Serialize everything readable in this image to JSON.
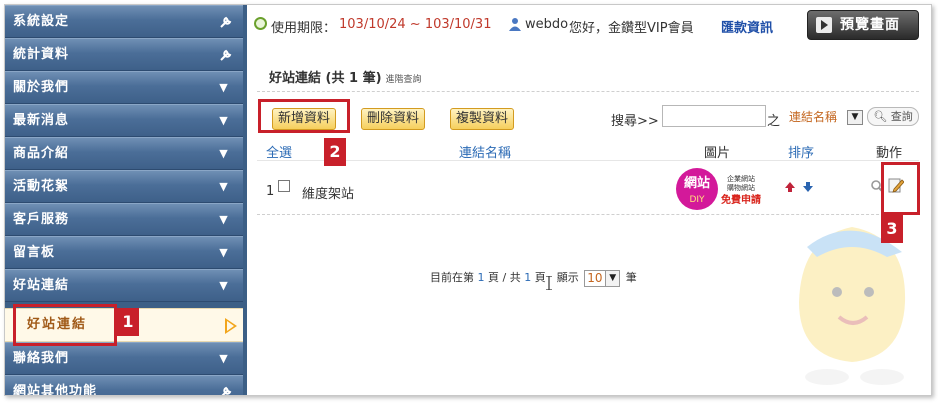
{
  "sidebar": {
    "items": [
      {
        "label": "系統設定",
        "icon": "wrench-icon"
      },
      {
        "label": "統計資料",
        "icon": "wrench-icon"
      },
      {
        "label": "關於我們",
        "icon": "chevron-down-icon"
      },
      {
        "label": "最新消息",
        "icon": "chevron-down-icon"
      },
      {
        "label": "商品介紹",
        "icon": "chevron-down-icon"
      },
      {
        "label": "活動花絮",
        "icon": "chevron-down-icon"
      },
      {
        "label": "客戶服務",
        "icon": "chevron-down-icon"
      },
      {
        "label": "留言板",
        "icon": "chevron-down-icon"
      },
      {
        "label": "好站連結",
        "icon": "chevron-down-icon"
      },
      {
        "label": "聯絡我們",
        "icon": "chevron-down-icon"
      },
      {
        "label": "網站其他功能",
        "icon": "wrench-icon"
      }
    ],
    "active_sub": "好站連結"
  },
  "topbar": {
    "usage_label": "使用期限：",
    "date_range": "103/10/24 ~ 103/10/31",
    "username": "webdo",
    "greeting": "您好，金鑽型VIP會員",
    "remit_link": "匯款資訊",
    "preview_button": "預覽畫面"
  },
  "page": {
    "title": "好站連結 (共 1 筆)",
    "advanced_search": "進階查詢"
  },
  "toolbar": {
    "new_label": "新增資料",
    "delete_label": "刪除資料",
    "copy_label": "複製資料"
  },
  "search": {
    "label": "搜尋>>",
    "value": "",
    "of_label": "之",
    "field_selected": "連結名稱",
    "query_button": "查詢"
  },
  "table": {
    "headers": {
      "select_all": "全選",
      "name": "連結名稱",
      "image": "圖片",
      "sort": "排序",
      "action": "動作"
    },
    "rows": [
      {
        "index": "1",
        "name": "維度架站",
        "image_text_top": "網站",
        "image_text_diy": "DIY",
        "image_text_line1": "企業網站",
        "image_text_line2": "購物網站",
        "image_text_free": "免費申請"
      }
    ]
  },
  "pager": {
    "prefix": "目前在第",
    "current": "1",
    "mid1": "頁 / 共",
    "total": "1",
    "mid2": "頁　顯示",
    "per_page": "10",
    "suffix": "筆"
  },
  "annotations": [
    "1",
    "2",
    "3"
  ],
  "colors": {
    "sidebar": "#3c5f86",
    "accent_red": "#c8202a",
    "link_blue": "#2c6bb5",
    "date_red": "#c0392b",
    "button_gold": "#f6cf5d"
  }
}
